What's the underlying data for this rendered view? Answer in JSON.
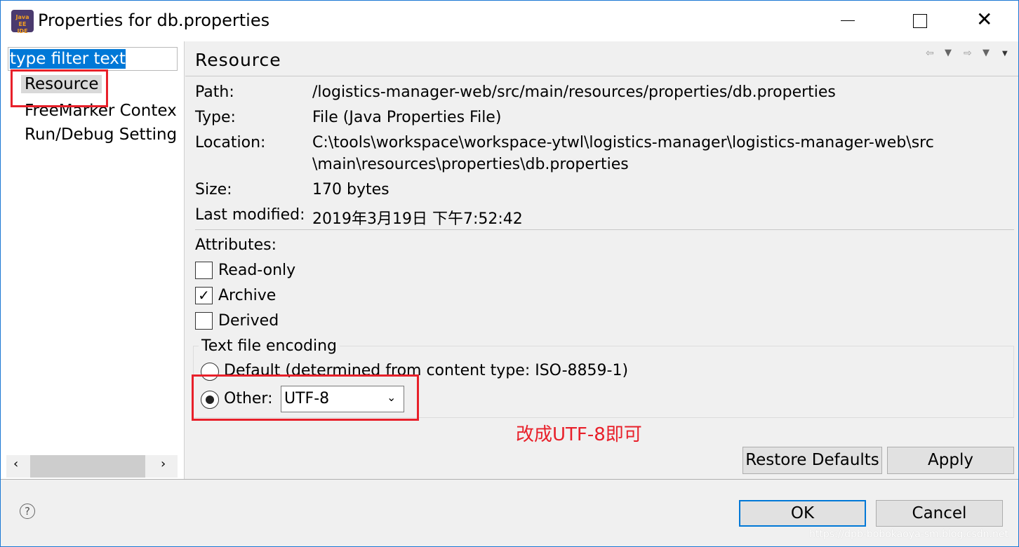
{
  "window": {
    "title": "Properties for db.properties",
    "app_icon_text": "Java EE IDE"
  },
  "sidebar": {
    "filter_text": "type filter text",
    "items": [
      {
        "label": "Resource",
        "selected": true
      },
      {
        "label": "FreeMarker Contex"
      },
      {
        "label": "Run/Debug Setting"
      }
    ]
  },
  "page": {
    "title": "Resource",
    "info": [
      {
        "label": "Path:",
        "value": "/logistics-manager-web/src/main/resources/properties/db.properties"
      },
      {
        "label": "Type:",
        "value": "File  (Java Properties File)"
      },
      {
        "label": "Location:",
        "value": "C:\\tools\\workspace\\workspace-ytwl\\logistics-manager\\logistics-manager-web\\src",
        "value2": "\\main\\resources\\properties\\db.properties"
      },
      {
        "label": "Size:",
        "value": "170  bytes"
      },
      {
        "label": "Last modified:",
        "value": "2019年3月19日 下午7:52:42"
      }
    ],
    "attributes_label": "Attributes:",
    "attributes": [
      {
        "label": "Read-only",
        "checked": false
      },
      {
        "label": "Archive",
        "checked": true
      },
      {
        "label": "Derived",
        "checked": false
      }
    ],
    "encoding": {
      "group_label": "Text file encoding",
      "default_label": "Default (determined from content type: ISO-8859-1)",
      "other_label": "Other:",
      "other_selected": true,
      "other_value": "UTF-8"
    },
    "annotation": "改成UTF-8即可",
    "restore_defaults": "Restore Defaults",
    "apply": "Apply"
  },
  "footer": {
    "ok": "OK",
    "cancel": "Cancel",
    "help": "?"
  },
  "watermark": "https://dpb-bobokaoya-sm.blog.csdn.net",
  "colors": {
    "accent": "#0078d7",
    "annotation": "#e8202a"
  }
}
